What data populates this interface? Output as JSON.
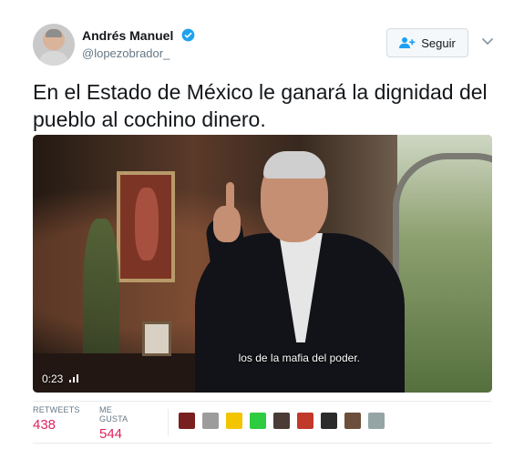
{
  "author": {
    "display_name": "Andrés Manuel",
    "handle": "@lopezobrador_",
    "verified": true,
    "avatar_icon": "user-avatar"
  },
  "follow_button": {
    "label": "Seguir",
    "icon": "follow-user-icon"
  },
  "more_menu_icon": "chevron-down-icon",
  "tweet": {
    "text": "En el Estado de México le ganará la dignidad del pueblo al cochino dinero."
  },
  "video": {
    "subtitle": "los de la mafia del poder.",
    "duration": "0:23",
    "volume_icon": "signal-bars-icon"
  },
  "stats": {
    "retweets_label": "RETWEETS",
    "retweets_value": "438",
    "likes_label": "ME GUSTA",
    "likes_value": "544"
  },
  "likers": [
    {
      "name": "liker-1",
      "color": "#7a1f1f"
    },
    {
      "name": "liker-2",
      "color": "#9c9c9c"
    },
    {
      "name": "liker-3",
      "color": "#f2c500"
    },
    {
      "name": "liker-4",
      "color": "#2ecc40"
    },
    {
      "name": "liker-5",
      "color": "#4a3b36"
    },
    {
      "name": "liker-6",
      "color": "#c0392b"
    },
    {
      "name": "liker-7",
      "color": "#2b2b2b"
    },
    {
      "name": "liker-8",
      "color": "#6b4f3a"
    },
    {
      "name": "liker-9",
      "color": "#95a5a6"
    }
  ],
  "colors": {
    "like_count": "#e0245e",
    "verified_badge": "#1da1f2",
    "follow_icon": "#1da1f2",
    "muted_text": "#657786"
  }
}
